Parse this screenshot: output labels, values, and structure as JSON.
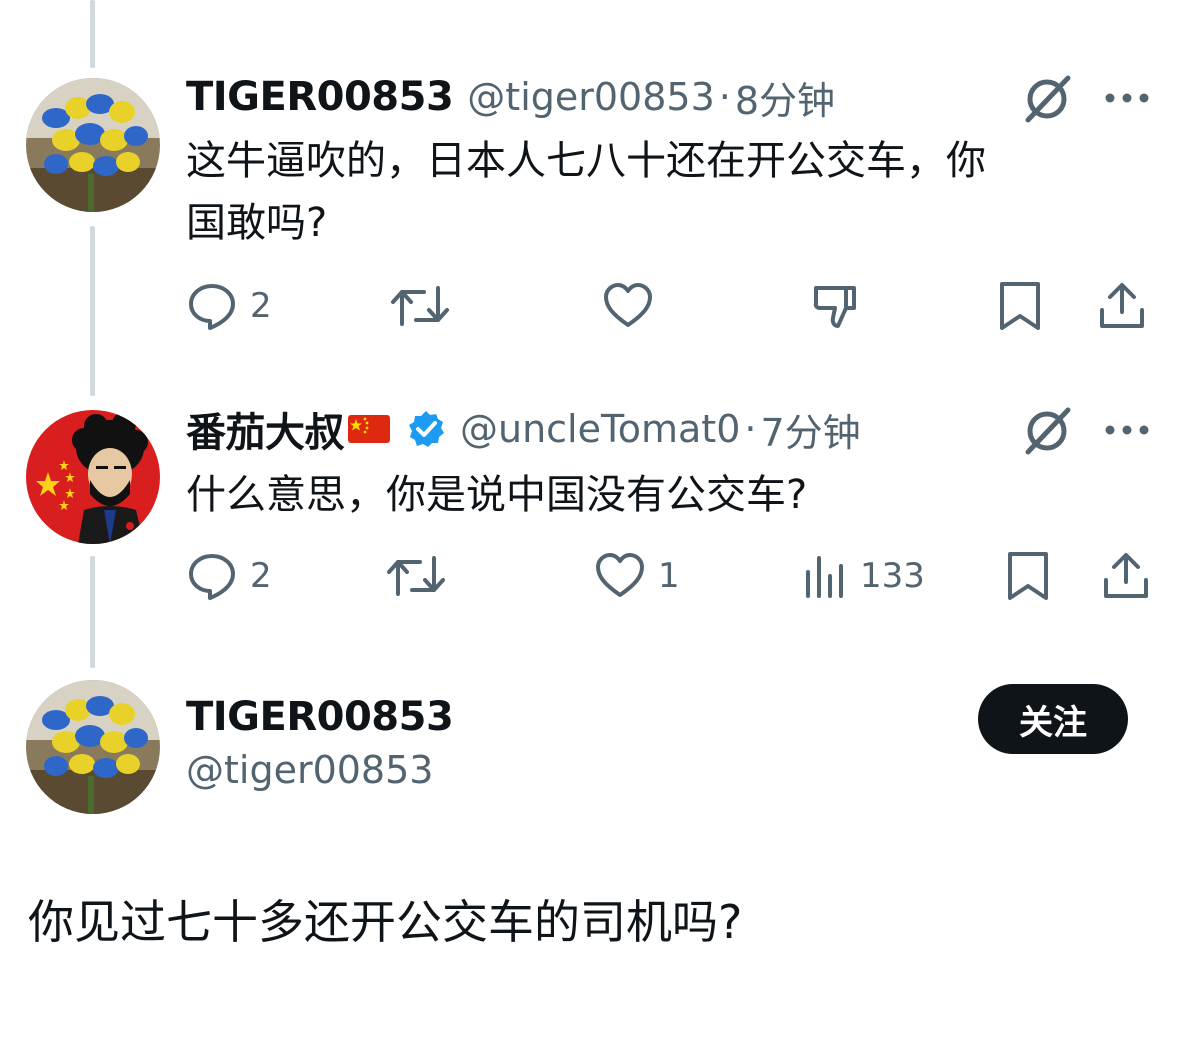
{
  "tweet1": {
    "name": "TIGER00853",
    "handle": "@tiger00853",
    "separator": "·",
    "time": "8分钟",
    "text_line1": "这牛逼吹的，日本人七八十还在开公交车，你",
    "text_line2": "国敢吗?",
    "reply_count": "2"
  },
  "tweet2": {
    "name": "番茄大叔",
    "handle": "@uncleTomat0",
    "separator": "·",
    "time": "7分钟",
    "text": "什么意思，你是说中国没有公交车?",
    "reply_count": "2",
    "like_count": "1",
    "view_count": "133"
  },
  "tweet3": {
    "name": "TIGER00853",
    "handle": "@tiger00853",
    "follow_label": "关注",
    "text": "你见过七十多还开公交车的司机吗?"
  },
  "colors": {
    "text": "#0f1419",
    "secondary": "#536471",
    "verified": "#1d9bf0",
    "thread_line": "#cfd9de"
  },
  "icons": [
    "reply-icon",
    "retweet-icon",
    "like-icon",
    "dislike-icon",
    "views-icon",
    "bookmark-icon",
    "share-icon",
    "grok-icon",
    "more-icon",
    "verified-icon",
    "china-flag-icon"
  ]
}
